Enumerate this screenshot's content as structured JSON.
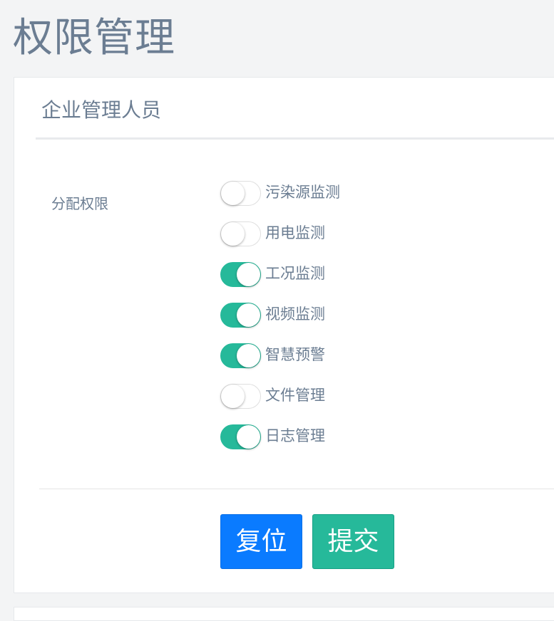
{
  "page": {
    "title": "权限管理"
  },
  "card": {
    "title": "企业管理人员",
    "form_label": "分配权限"
  },
  "permissions": [
    {
      "label": "污染源监测",
      "enabled": false
    },
    {
      "label": "用电监测",
      "enabled": false
    },
    {
      "label": "工况监测",
      "enabled": true
    },
    {
      "label": "视频监测",
      "enabled": true
    },
    {
      "label": "智慧预警",
      "enabled": true
    },
    {
      "label": "文件管理",
      "enabled": false
    },
    {
      "label": "日志管理",
      "enabled": true
    }
  ],
  "buttons": {
    "reset_label": "复位",
    "submit_label": "提交"
  },
  "colors": {
    "toggle_on": "#26b99a",
    "reset_button": "#0a7bff",
    "submit_button": "#26b99a"
  }
}
